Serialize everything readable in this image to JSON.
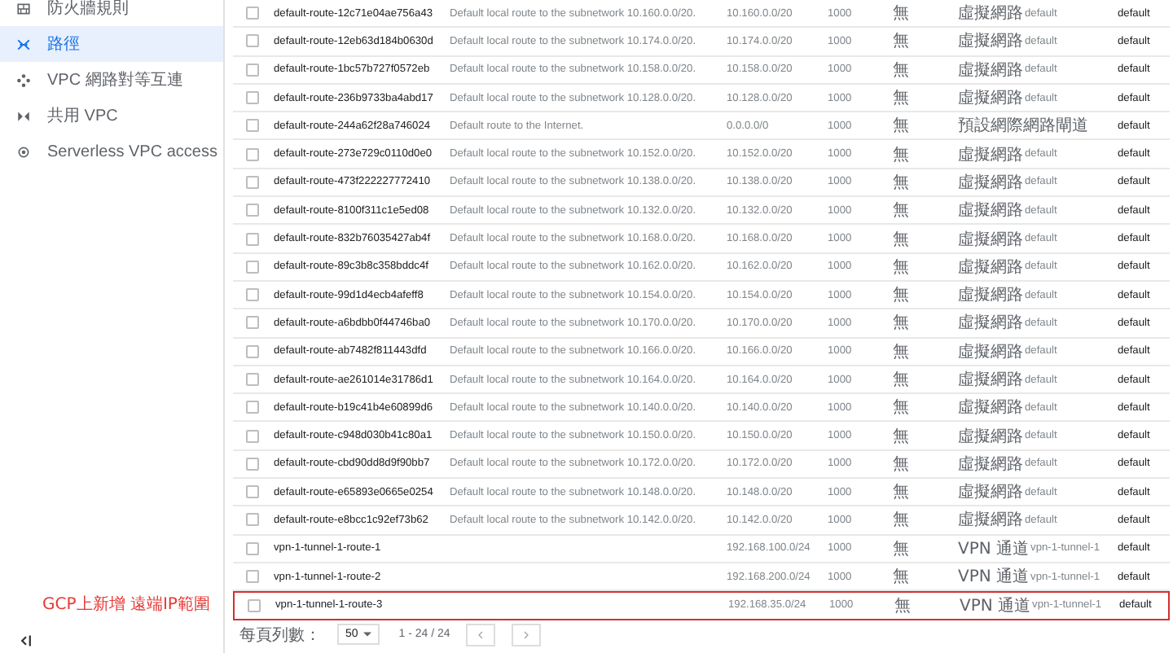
{
  "sidebar": {
    "items": [
      {
        "label": "防火牆規則",
        "selected": false
      },
      {
        "label": "路徑",
        "selected": true
      },
      {
        "label": "VPC 網路對等互連",
        "selected": false
      },
      {
        "label": "共用 VPC",
        "selected": false
      },
      {
        "label": "Serverless VPC access",
        "selected": false
      }
    ]
  },
  "table": {
    "rows": [
      {
        "checked": false,
        "highlighted": false,
        "name": "default-route-12c71e04ae756a43",
        "description": "Default local route to the subnetwork 10.160.0.0/20.",
        "destination": "10.160.0.0/20",
        "priority": "1000",
        "tags": "無",
        "next_hop": "虛擬網路",
        "next_hop_name": "default",
        "network": "default"
      },
      {
        "checked": false,
        "highlighted": false,
        "name": "default-route-12eb63d184b0630d",
        "description": "Default local route to the subnetwork 10.174.0.0/20.",
        "destination": "10.174.0.0/20",
        "priority": "1000",
        "tags": "無",
        "next_hop": "虛擬網路",
        "next_hop_name": "default",
        "network": "default"
      },
      {
        "checked": false,
        "highlighted": false,
        "name": "default-route-1bc57b727f0572eb",
        "description": "Default local route to the subnetwork 10.158.0.0/20.",
        "destination": "10.158.0.0/20",
        "priority": "1000",
        "tags": "無",
        "next_hop": "虛擬網路",
        "next_hop_name": "default",
        "network": "default"
      },
      {
        "checked": false,
        "highlighted": false,
        "name": "default-route-236b9733ba4abd17",
        "description": "Default local route to the subnetwork 10.128.0.0/20.",
        "destination": "10.128.0.0/20",
        "priority": "1000",
        "tags": "無",
        "next_hop": "虛擬網路",
        "next_hop_name": "default",
        "network": "default"
      },
      {
        "checked": false,
        "highlighted": false,
        "name": "default-route-244a62f28a746024",
        "description": "Default route to the Internet.",
        "destination": "0.0.0.0/0",
        "priority": "1000",
        "tags": "無",
        "next_hop": "預設網際網路閘道",
        "network": "default"
      },
      {
        "checked": false,
        "highlighted": false,
        "name": "default-route-273e729c0110d0e0",
        "description": "Default local route to the subnetwork 10.152.0.0/20.",
        "destination": "10.152.0.0/20",
        "priority": "1000",
        "tags": "無",
        "next_hop": "虛擬網路",
        "next_hop_name": "default",
        "network": "default"
      },
      {
        "checked": false,
        "highlighted": false,
        "name": "default-route-473f222227772410",
        "description": "Default local route to the subnetwork 10.138.0.0/20.",
        "destination": "10.138.0.0/20",
        "priority": "1000",
        "tags": "無",
        "next_hop": "虛擬網路",
        "next_hop_name": "default",
        "network": "default"
      },
      {
        "checked": false,
        "highlighted": false,
        "name": "default-route-8100f311c1e5ed08",
        "description": "Default local route to the subnetwork 10.132.0.0/20.",
        "destination": "10.132.0.0/20",
        "priority": "1000",
        "tags": "無",
        "next_hop": "虛擬網路",
        "next_hop_name": "default",
        "network": "default"
      },
      {
        "checked": false,
        "highlighted": false,
        "name": "default-route-832b76035427ab4f",
        "description": "Default local route to the subnetwork 10.168.0.0/20.",
        "destination": "10.168.0.0/20",
        "priority": "1000",
        "tags": "無",
        "next_hop": "虛擬網路",
        "next_hop_name": "default",
        "network": "default"
      },
      {
        "checked": false,
        "highlighted": false,
        "name": "default-route-89c3b8c358bddc4f",
        "description": "Default local route to the subnetwork 10.162.0.0/20.",
        "destination": "10.162.0.0/20",
        "priority": "1000",
        "tags": "無",
        "next_hop": "虛擬網路",
        "next_hop_name": "default",
        "network": "default"
      },
      {
        "checked": false,
        "highlighted": false,
        "name": "default-route-99d1d4ecb4afeff8",
        "description": "Default local route to the subnetwork 10.154.0.0/20.",
        "destination": "10.154.0.0/20",
        "priority": "1000",
        "tags": "無",
        "next_hop": "虛擬網路",
        "next_hop_name": "default",
        "network": "default"
      },
      {
        "checked": false,
        "highlighted": false,
        "name": "default-route-a6bdbb0f44746ba0",
        "description": "Default local route to the subnetwork 10.170.0.0/20.",
        "destination": "10.170.0.0/20",
        "priority": "1000",
        "tags": "無",
        "next_hop": "虛擬網路",
        "next_hop_name": "default",
        "network": "default"
      },
      {
        "checked": false,
        "highlighted": false,
        "name": "default-route-ab7482f811443dfd",
        "description": "Default local route to the subnetwork 10.166.0.0/20.",
        "destination": "10.166.0.0/20",
        "priority": "1000",
        "tags": "無",
        "next_hop": "虛擬網路",
        "next_hop_name": "default",
        "network": "default"
      },
      {
        "checked": false,
        "highlighted": false,
        "name": "default-route-ae261014e31786d1",
        "description": "Default local route to the subnetwork 10.164.0.0/20.",
        "destination": "10.164.0.0/20",
        "priority": "1000",
        "tags": "無",
        "next_hop": "虛擬網路",
        "next_hop_name": "default",
        "network": "default"
      },
      {
        "checked": false,
        "highlighted": false,
        "name": "default-route-b19c41b4e60899d6",
        "description": "Default local route to the subnetwork 10.140.0.0/20.",
        "destination": "10.140.0.0/20",
        "priority": "1000",
        "tags": "無",
        "next_hop": "虛擬網路",
        "next_hop_name": "default",
        "network": "default"
      },
      {
        "checked": false,
        "highlighted": false,
        "name": "default-route-c948d030b41c80a1",
        "description": "Default local route to the subnetwork 10.150.0.0/20.",
        "destination": "10.150.0.0/20",
        "priority": "1000",
        "tags": "無",
        "next_hop": "虛擬網路",
        "next_hop_name": "default",
        "network": "default"
      },
      {
        "checked": false,
        "highlighted": false,
        "name": "default-route-cbd90dd8d9f90bb7",
        "description": "Default local route to the subnetwork 10.172.0.0/20.",
        "destination": "10.172.0.0/20",
        "priority": "1000",
        "tags": "無",
        "next_hop": "虛擬網路",
        "next_hop_name": "default",
        "network": "default"
      },
      {
        "checked": false,
        "highlighted": false,
        "name": "default-route-e65893e0665e0254",
        "description": "Default local route to the subnetwork 10.148.0.0/20.",
        "destination": "10.148.0.0/20",
        "priority": "1000",
        "tags": "無",
        "next_hop": "虛擬網路",
        "next_hop_name": "default",
        "network": "default"
      },
      {
        "checked": false,
        "highlighted": false,
        "name": "default-route-e8bcc1c92ef73b62",
        "description": "Default local route to the subnetwork 10.142.0.0/20.",
        "destination": "10.142.0.0/20",
        "priority": "1000",
        "tags": "無",
        "next_hop": "虛擬網路",
        "next_hop_name": "default",
        "network": "default"
      },
      {
        "checked": false,
        "highlighted": false,
        "name": "vpn-1-tunnel-1-route-1",
        "destination": "192.168.100.0/24",
        "priority": "1000",
        "tags": "無",
        "next_hop": "VPN 通道",
        "next_hop_name": "vpn-1-tunnel-1",
        "network": "default"
      },
      {
        "checked": false,
        "highlighted": false,
        "name": "vpn-1-tunnel-1-route-2",
        "destination": "192.168.200.0/24",
        "priority": "1000",
        "tags": "無",
        "next_hop": "VPN 通道",
        "next_hop_name": "vpn-1-tunnel-1",
        "network": "default"
      },
      {
        "checked": false,
        "highlighted": true,
        "name": "vpn-1-tunnel-1-route-3",
        "destination": "192.168.35.0/24",
        "priority": "1000",
        "tags": "無",
        "next_hop": "VPN 通道",
        "next_hop_name": "vpn-1-tunnel-1",
        "network": "default"
      }
    ]
  },
  "annotation": "GCP上新增 遠端IP範圍",
  "pagination": {
    "rows_per_page_label": "每頁列數：",
    "rows_per_page": "50",
    "range": "1 - 24 / 24"
  }
}
